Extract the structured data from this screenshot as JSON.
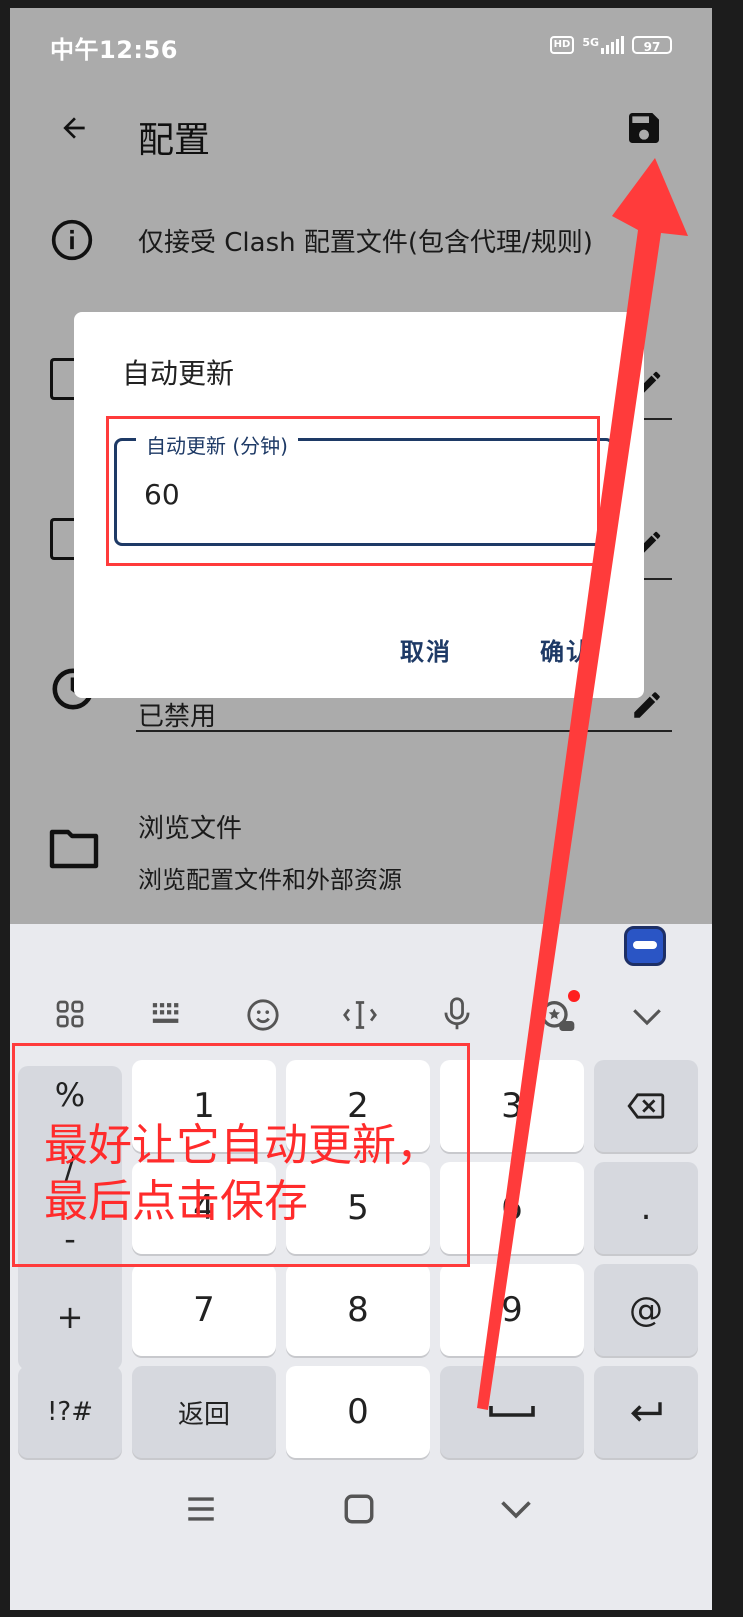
{
  "status_bar": {
    "time": "中午12:56",
    "hd_label": "HD",
    "network": "5G",
    "battery": "97"
  },
  "header": {
    "title": "配置",
    "back_icon": "arrow-left-icon",
    "save_icon": "save-icon"
  },
  "info_row": {
    "text": "仅接受 Clash 配置文件(包含代理/规则)"
  },
  "auto_update_row": {
    "value": "已禁用"
  },
  "browse_row": {
    "title": "浏览文件",
    "subtitle": "浏览配置文件和外部资源"
  },
  "dialog": {
    "title": "自动更新",
    "field_label": "自动更新 (分钟)",
    "field_value": "60",
    "cancel": "取消",
    "confirm": "确认"
  },
  "keyboard": {
    "toolbar_icons": [
      "apps-grid-icon",
      "keyboard-icon",
      "emoji-icon",
      "cursor-icon",
      "microphone-icon",
      "ad-badge-icon",
      "chevron-down-icon"
    ],
    "side_symbols": [
      "%",
      "/",
      "-",
      "+"
    ],
    "digits": [
      "1",
      "2",
      "3",
      "4",
      "5",
      "6",
      "7",
      "8",
      "9",
      "0"
    ],
    "dot": ".",
    "at": "@",
    "symbols": "!?#",
    "back_label": "返回"
  },
  "annotation": {
    "text": "最好让它自动更新，\n最后点击保存",
    "color": "#ff2b2b"
  },
  "colors": {
    "accent": "#1e3a66",
    "annotation": "#ff3b3b",
    "scrim": "#ababab"
  }
}
